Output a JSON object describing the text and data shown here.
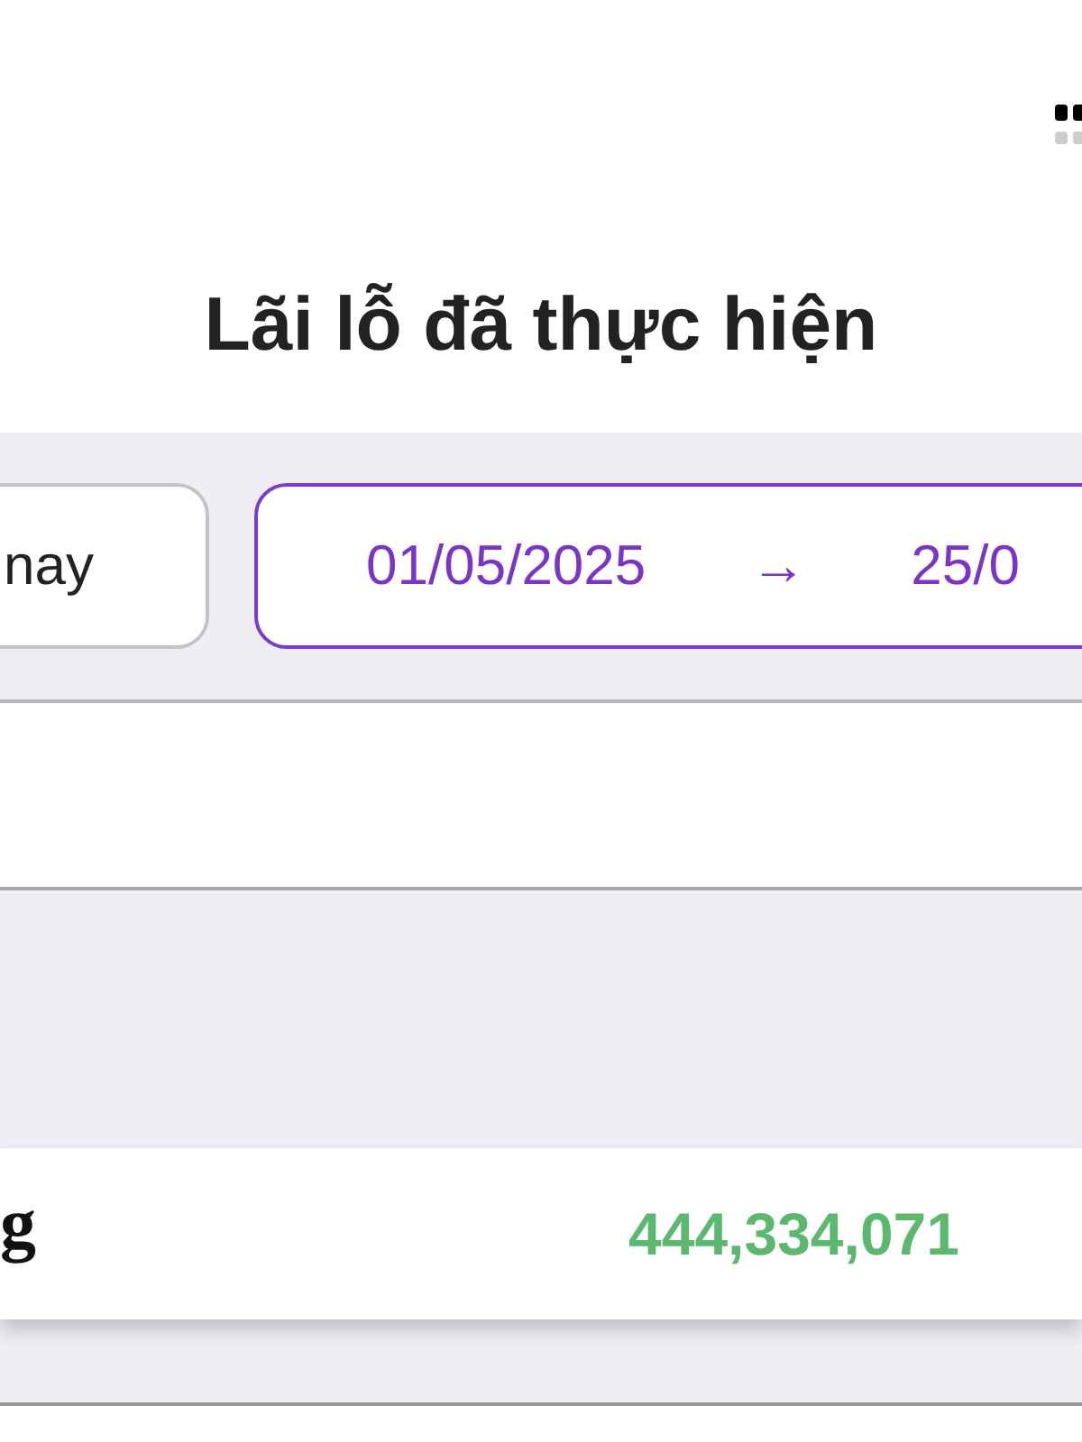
{
  "title": "Lãi lỗ đã thực hiện",
  "filters": {
    "period": "nay",
    "date_from": "01/05/2025",
    "arrow": "→",
    "date_to": "25/0"
  },
  "summary_row": {
    "label": "g",
    "value": "444,334,071"
  }
}
